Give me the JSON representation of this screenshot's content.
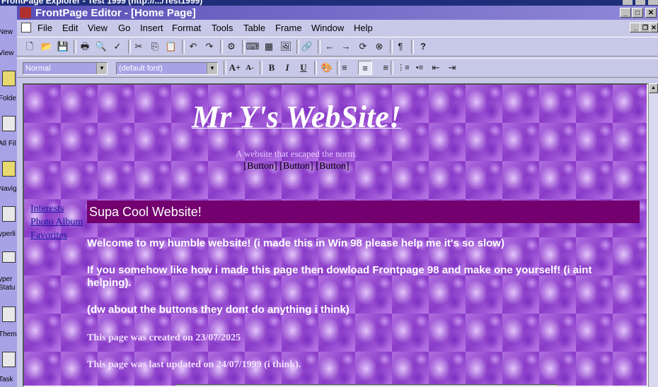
{
  "background_window": {
    "title": "FrontPage Explorer - Test 1999 (http://.../Test1999)",
    "left_pane_labels": [
      "New",
      "View",
      "Folde",
      "All Fil",
      "Naviga",
      "yperli",
      "yper Statu",
      "Them",
      "Task"
    ]
  },
  "window": {
    "title": "FrontPage Editor - [Home Page]",
    "caption_buttons": {
      "minimize": "_",
      "maximize": "□",
      "close": "✕"
    },
    "mdi_buttons": {
      "minimize": "_",
      "restore": "❐",
      "close": "✕"
    }
  },
  "menubar": {
    "items": [
      "File",
      "Edit",
      "View",
      "Go",
      "Insert",
      "Format",
      "Tools",
      "Table",
      "Frame",
      "Window",
      "Help"
    ]
  },
  "toolbar_standard": {
    "icons": [
      "new-page-icon",
      "open-icon",
      "save-icon",
      "print-icon",
      "print-preview-icon",
      "spelling-icon",
      "cut-icon",
      "copy-icon",
      "paste-icon",
      "undo-icon",
      "redo-icon",
      "web-component-icon",
      "insert-form-field-icon",
      "insert-table-icon",
      "insert-image-icon",
      "hyperlink-icon",
      "back-icon",
      "forward-icon",
      "refresh-icon",
      "stop-icon",
      "show-paragraph-icon",
      "help-icon"
    ],
    "glyphs": [
      "🗋",
      "📂",
      "💾",
      "🖶",
      "🔍",
      "✓",
      "✂",
      "⎘",
      "📋",
      "↶",
      "↷",
      "⚙",
      "⌨",
      "▦",
      "🖼",
      "🔗",
      "←",
      "→",
      "⟳",
      "⊗",
      "¶",
      "?"
    ]
  },
  "toolbar_format": {
    "style_value": "Normal",
    "font_value": "(default font)",
    "buttons": [
      "A+",
      "A-",
      "B",
      "I",
      "U"
    ],
    "align_glyphs": [
      "≡",
      "≡",
      "≡"
    ],
    "list_glyphs": [
      "⋮≡",
      "•≡",
      "⇤",
      "⇥"
    ]
  },
  "page": {
    "site_title": "Mr Y's WebSite!",
    "tagline": "A website that escaped the norm.",
    "buttons_text": "[Button] [Button] [Button]",
    "sidenav": [
      "Interests",
      "Photo Album",
      "Favorites"
    ],
    "banner": "Supa Cool Website!",
    "paragraphs": [
      "Welcome to my humble website! (i made this in Win 98 please help me it's so slow)",
      "If you somehow like how i made this page then dowload Frontpage 98 and make one yourself! (i aint helping).",
      "(dw about the buttons they dont do anything i think)"
    ],
    "created": "This page was created on 23/07/2025",
    "updated": "This page was last updated on 24/07/1999 (i think)."
  },
  "colors": {
    "title_gradient_start": "#5a50b8",
    "banner_bg": "#73006e",
    "link": "#1818a0",
    "chrome": "#c8c8e8"
  }
}
